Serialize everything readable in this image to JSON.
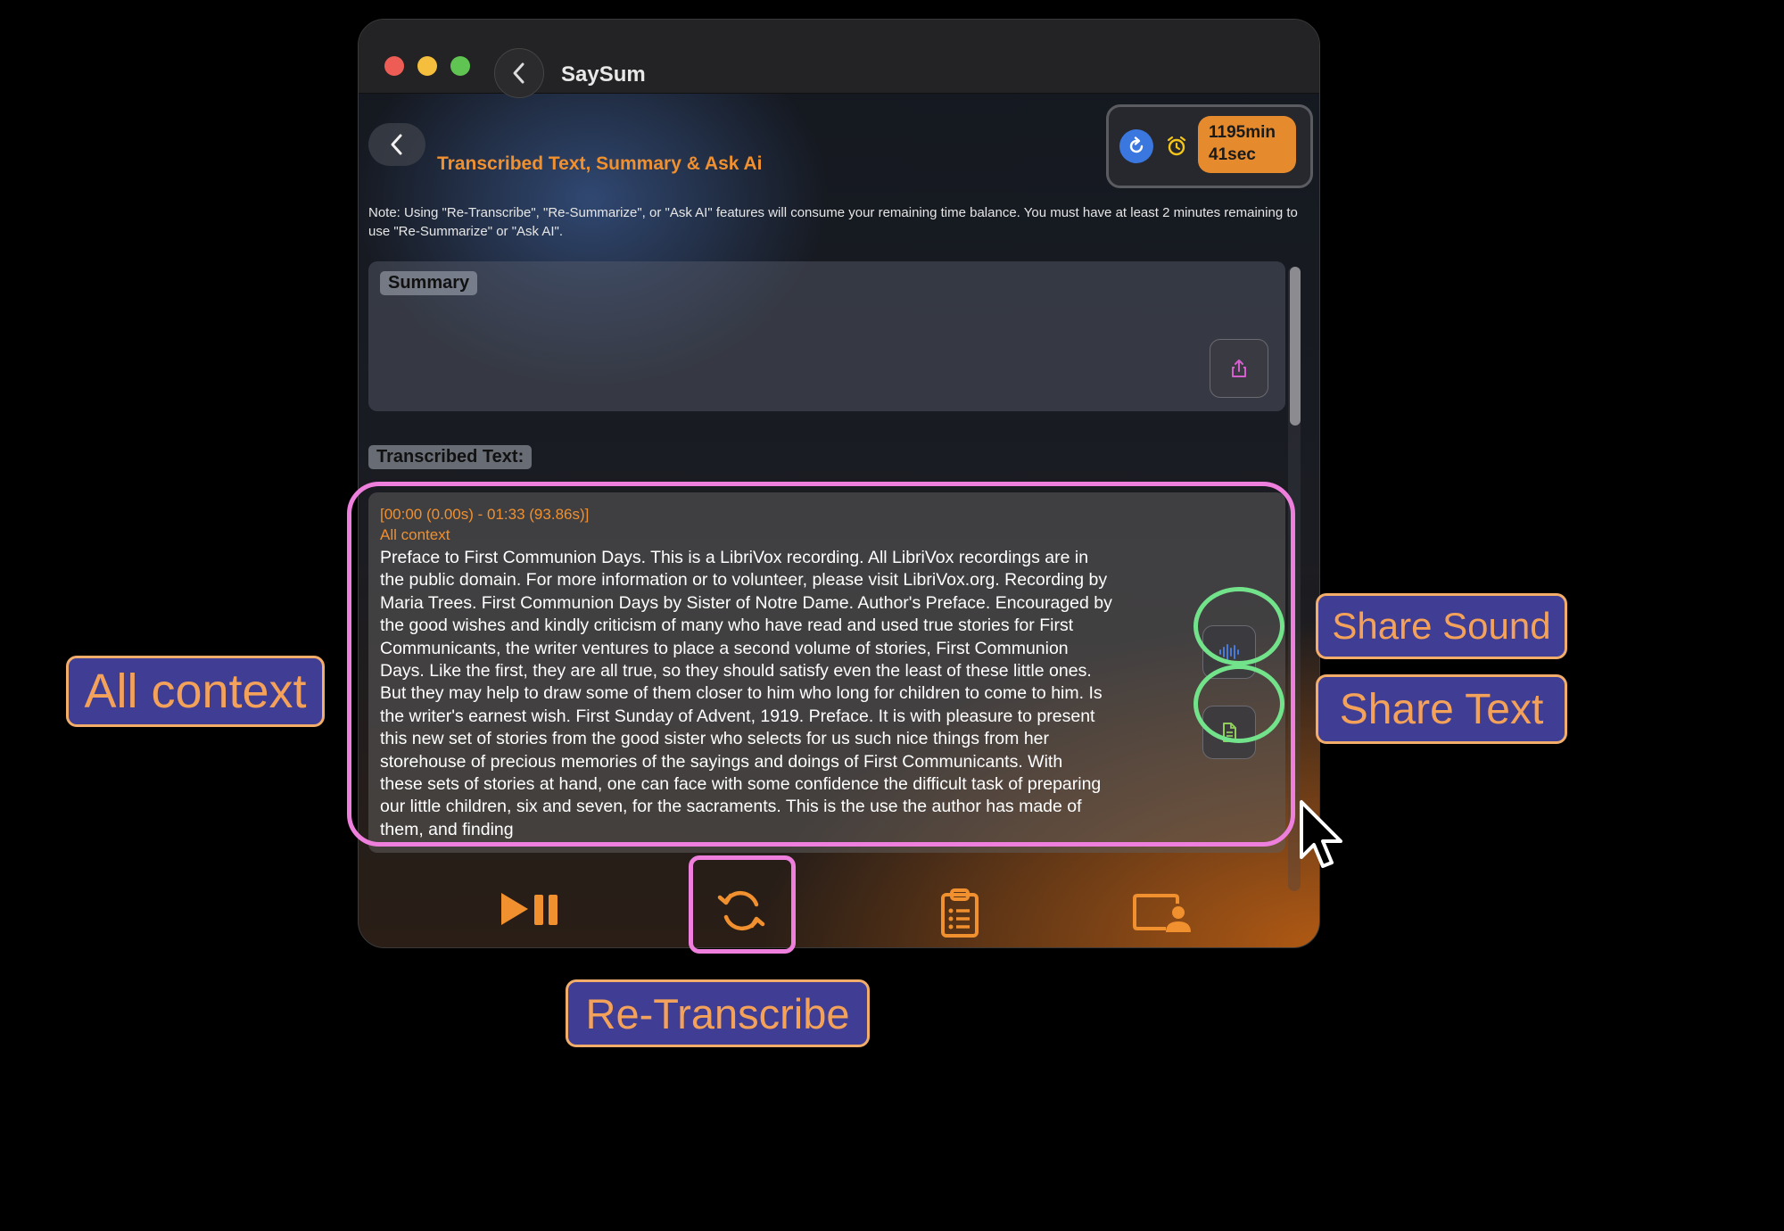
{
  "window": {
    "title": "SaySum"
  },
  "header": {
    "title": "Transcribed Text, Summary & Ask Ai"
  },
  "status": {
    "time_remaining": [
      "1195min",
      "41sec"
    ]
  },
  "note": "Note: Using \"Re-Transcribe\", \"Re-Summarize\", or \"Ask AI\" features will consume your remaining time balance. You must have at least 2 minutes remaining to use \"Re-Summarize\" or \"Ask AI\".",
  "summary": {
    "label": "Summary",
    "text": ""
  },
  "transcription": {
    "label": "Transcribed Text:",
    "segments": [
      {
        "time_range": "[00:00 (0.00s) - 01:33 (93.86s)]",
        "context": "All context",
        "text_lines": [
          "Preface to First Communion Days. This is a LibriVox recording. All LibriVox recordings are in",
          "the public domain. For more information or to volunteer, please visit LibriVox.org. Recording by",
          "Maria Trees. First Communion Days by Sister of Notre Dame. Author's Preface. Encouraged by",
          "the good wishes and kindly criticism of many who have read and used true stories for First",
          "Communicants, the writer ventures to place a second volume of stories, First Communion",
          "Days. Like the first, they are all true, so they should satisfy even the least of these little ones.",
          "But they may help to draw some of them closer to him who long for children to come to him. Is",
          "the writer's earnest wish. First Sunday of Advent, 1919. Preface. It is with pleasure to present",
          "this new set of stories from the good sister who selects for us such nice things from her",
          "storehouse of precious memories of the sayings and doings of First Communicants. With",
          "these sets of stories at hand, one can face with some confidence the difficult task of preparing",
          "our little children, six and seven, for the sacraments. This is the use the author has made of",
          "them, and finding"
        ]
      }
    ]
  },
  "toolbar": [
    "play-pause-icon",
    "re-transcribe-icon",
    "clipboard-icon",
    "screen-share-icon"
  ],
  "annotations": {
    "all_context": "All context",
    "share_sound": "Share Sound",
    "share_text": "Share Text",
    "re_transcribe": "Re-Transcribe"
  },
  "colors": {
    "accent": "#f0902e",
    "highlight_pink": "#ef7fdc",
    "highlight_green": "#72e38a",
    "callout_bg": "#3f3d94"
  }
}
